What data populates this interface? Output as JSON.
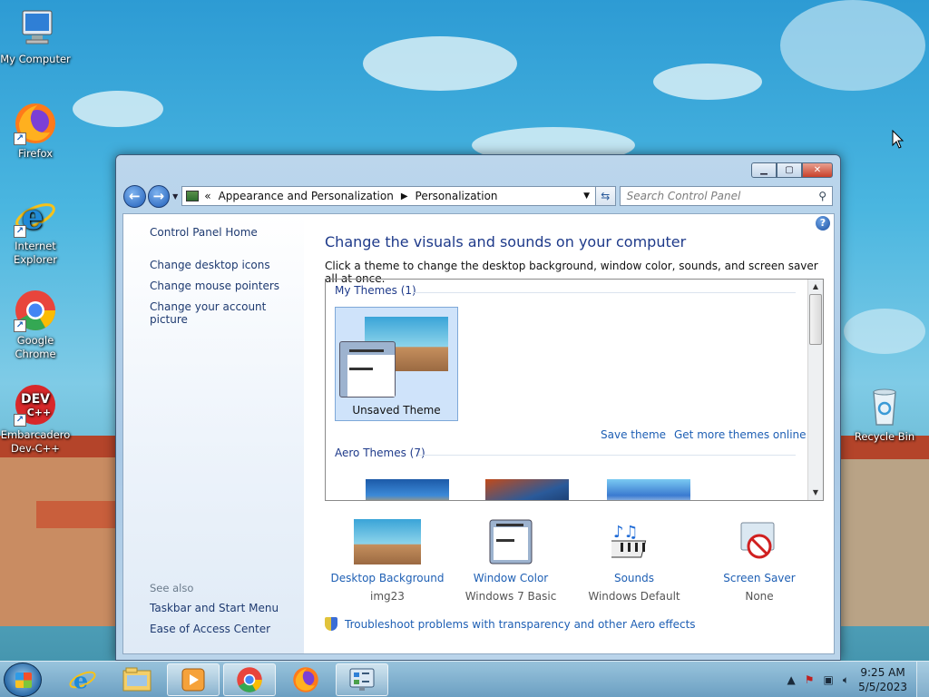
{
  "desktop": {
    "icons": [
      {
        "label": "My Computer"
      },
      {
        "label": "Firefox"
      },
      {
        "label": "Internet Explorer"
      },
      {
        "label": "Google Chrome"
      },
      {
        "label": "Embarcadero Dev-C++"
      },
      {
        "label": "Recycle Bin"
      }
    ],
    "dev_logo_text": "DEV",
    "dev_logo_sub": "C++"
  },
  "window": {
    "address": {
      "overflow": "«",
      "crumbs": [
        "Appearance and Personalization",
        "Personalization"
      ]
    },
    "search_placeholder": "Search Control Panel",
    "left_pane": {
      "links": [
        "Control Panel Home",
        "Change desktop icons",
        "Change mouse pointers",
        "Change your account picture"
      ],
      "see_also_label": "See also",
      "see_also_links": [
        "Taskbar and Start Menu",
        "Ease of Access Center"
      ]
    },
    "main": {
      "heading": "Change the visuals and sounds on your computer",
      "subtext": "Click a theme to change the desktop background, window color, sounds, and screen saver all at once.",
      "my_themes_label": "My Themes (1)",
      "selected_theme": "Unsaved Theme",
      "save_theme": "Save theme",
      "get_more": "Get more themes online",
      "aero_label": "Aero Themes (7)",
      "bottom": [
        {
          "label": "Desktop Background",
          "value": "img23"
        },
        {
          "label": "Window Color",
          "value": "Windows 7 Basic"
        },
        {
          "label": "Sounds",
          "value": "Windows Default"
        },
        {
          "label": "Screen Saver",
          "value": "None"
        }
      ],
      "troubleshoot": "Troubleshoot problems with transparency and other Aero effects"
    }
  },
  "taskbar": {
    "time": "9:25 AM",
    "date": "5/5/2023"
  }
}
